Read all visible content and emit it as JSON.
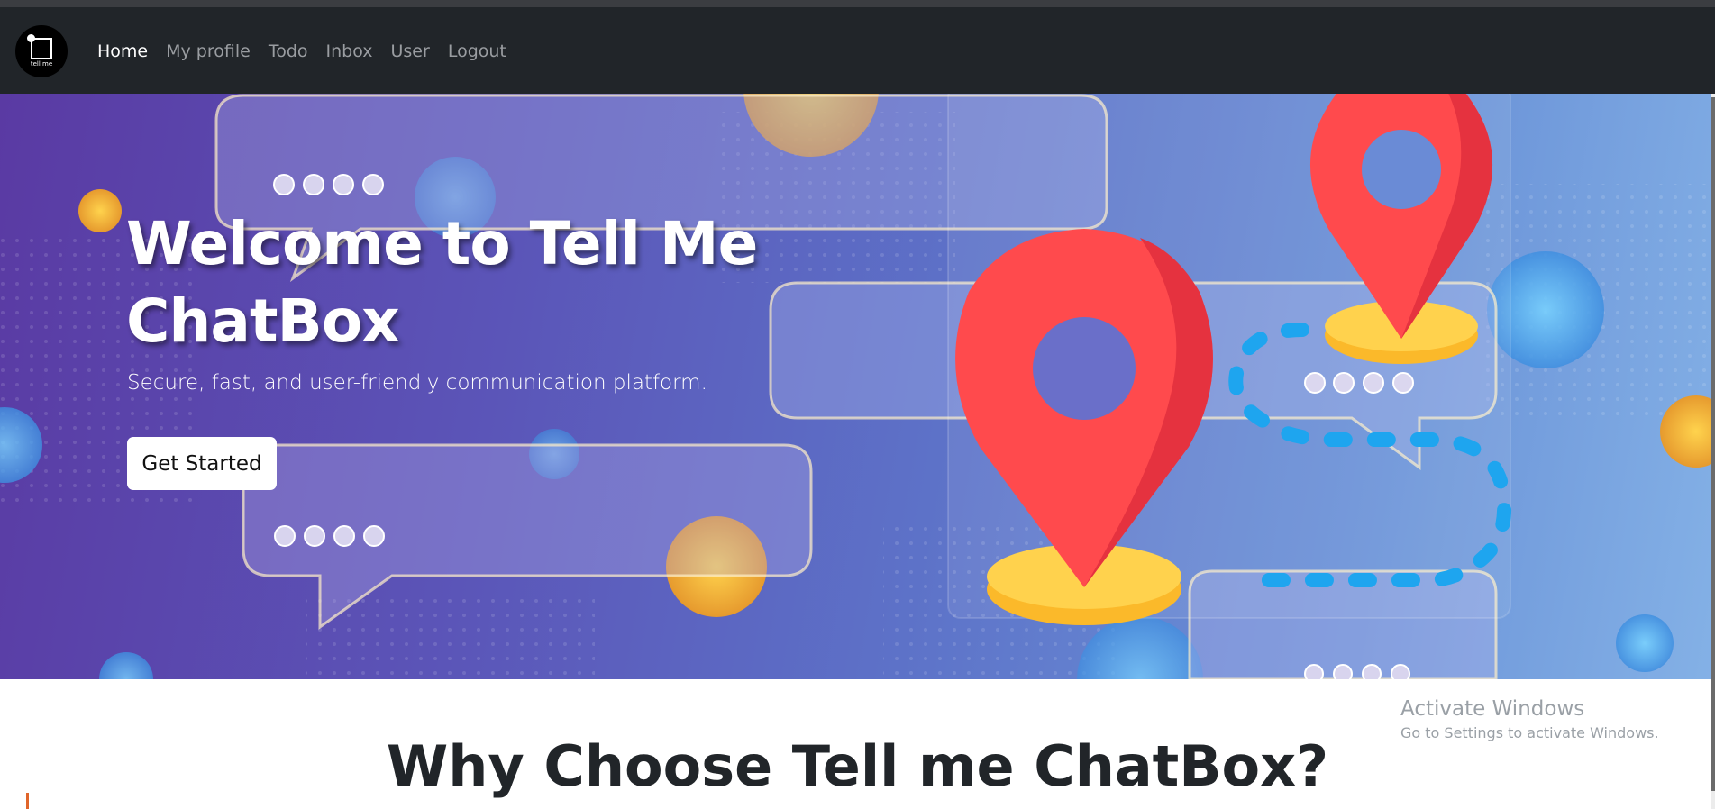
{
  "app": {
    "logo_text": "tell me",
    "logo_icon": "logo-icon"
  },
  "nav": {
    "items": [
      {
        "label": "Home",
        "active": true
      },
      {
        "label": "My profile",
        "active": false
      },
      {
        "label": "Todo",
        "active": false
      },
      {
        "label": "Inbox",
        "active": false
      },
      {
        "label": "User",
        "active": false
      },
      {
        "label": "Logout",
        "active": false
      }
    ]
  },
  "hero": {
    "title": "Welcome to Tell Me ChatBox",
    "subtitle": "Secure, fast, and user-friendly communication platform.",
    "cta_label": "Get Started",
    "illustration_icons": [
      "chat-bubble-icon",
      "location-pin-icon",
      "dotted-route-icon"
    ]
  },
  "section": {
    "heading": "Why Choose Tell me ChatBox?"
  },
  "watermark": {
    "title": "Activate Windows",
    "subtitle": "Go to Settings to activate Windows."
  },
  "colors": {
    "navbar": "#212529",
    "pin_red": "#ff4a4d",
    "pin_base": "#ffd24d",
    "route_blue": "#1ea5ef"
  }
}
